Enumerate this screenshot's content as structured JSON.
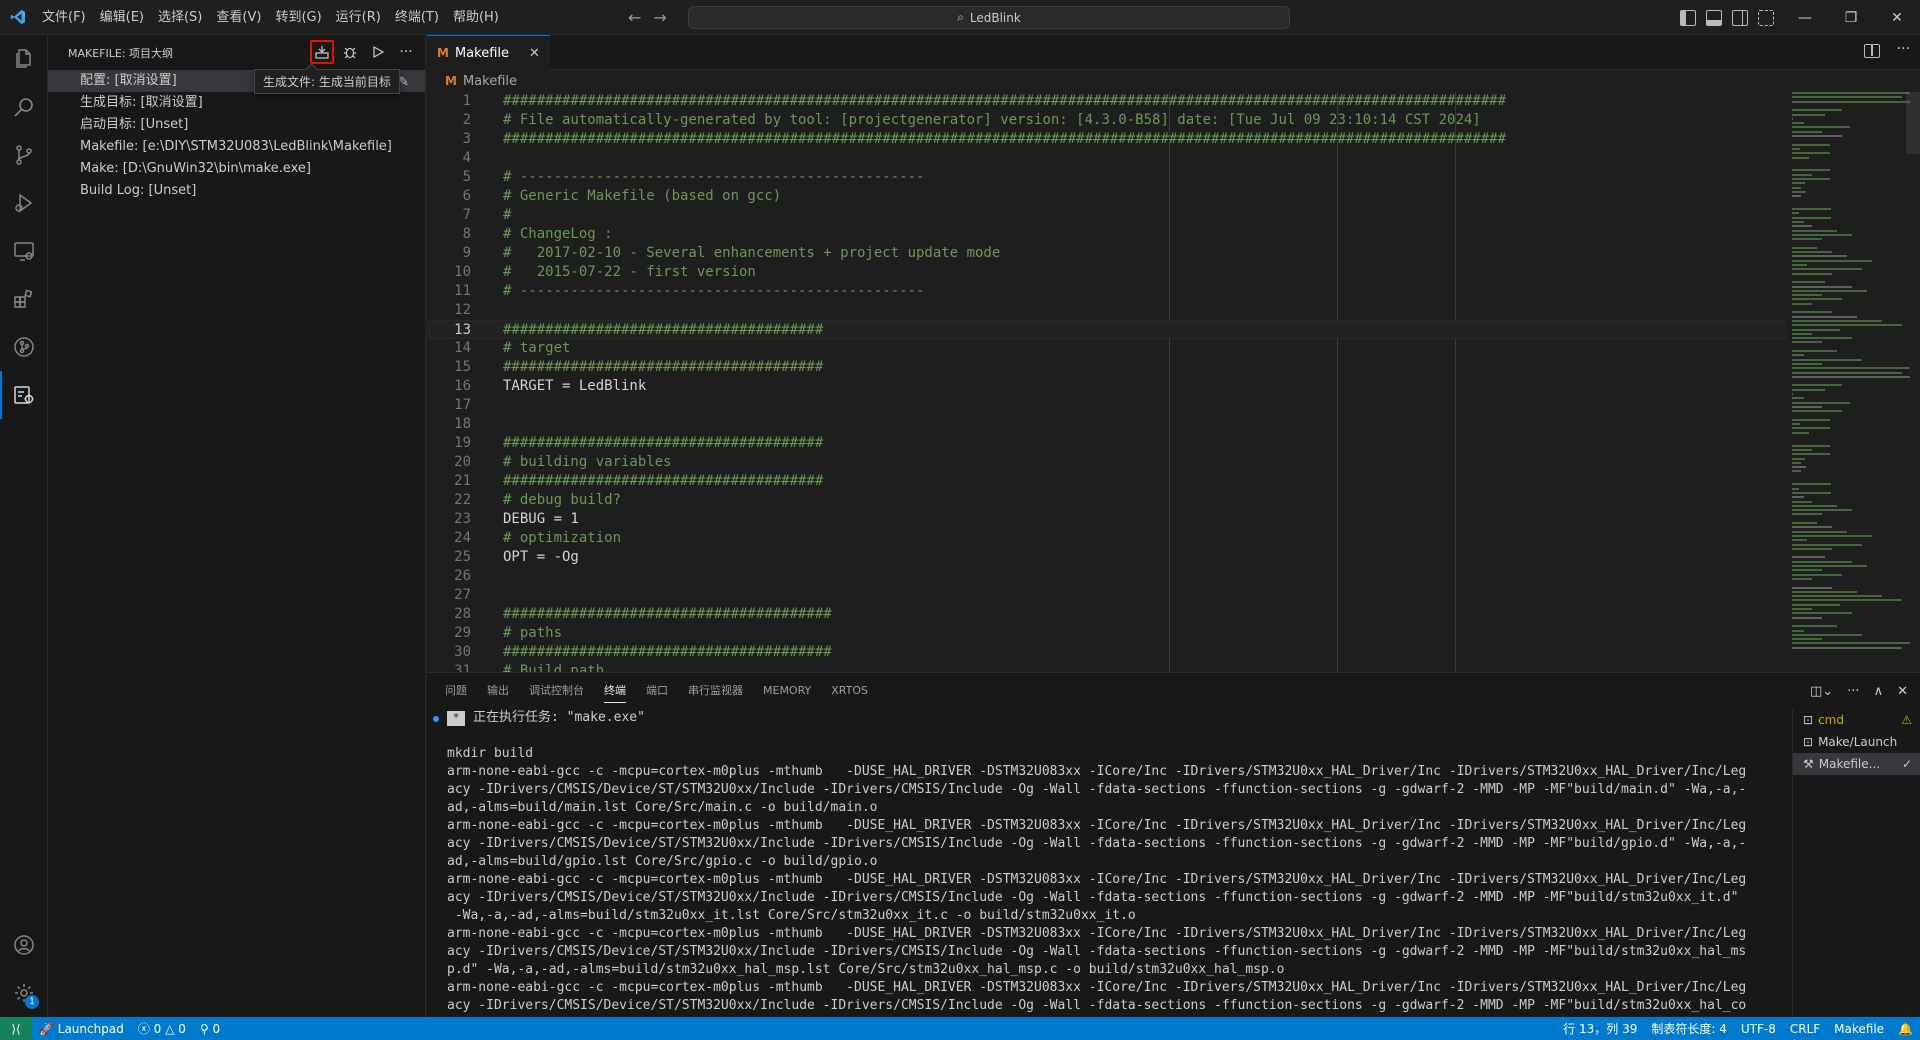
{
  "menu": [
    "文件(F)",
    "编辑(E)",
    "选择(S)",
    "查看(V)",
    "转到(G)",
    "运行(R)",
    "终端(T)",
    "帮助(H)"
  ],
  "command_center": {
    "text": "LedBlink"
  },
  "sidebar": {
    "title": "MAKEFILE: 项目大纲",
    "tooltip": "生成文件: 生成当前目标",
    "items": [
      {
        "label": "配置: [取消设置]"
      },
      {
        "label": "生成目标: [取消设置]"
      },
      {
        "label": "启动目标: [Unset]"
      },
      {
        "label": "Makefile: [e:\\DIY\\STM32U083\\LedBlink\\Makefile]"
      },
      {
        "label": "Make: [D:\\GnuWin32\\bin\\make.exe]"
      },
      {
        "label": "Build Log: [Unset]"
      }
    ]
  },
  "editor": {
    "tab": "Makefile",
    "breadcrumb": "Makefile",
    "lines": [
      {
        "n": "1",
        "t": "#######################################################################################################################",
        "c": true
      },
      {
        "n": "2",
        "t": "# File automatically-generated by tool: [projectgenerator] version: [4.3.0-B58] date: [Tue Jul 09 23:10:14 CST 2024]",
        "c": true
      },
      {
        "n": "3",
        "t": "#######################################################################################################################",
        "c": true
      },
      {
        "n": "4",
        "t": "",
        "c": false
      },
      {
        "n": "5",
        "t": "# ------------------------------------------------",
        "c": true
      },
      {
        "n": "6",
        "t": "# Generic Makefile (based on gcc)",
        "c": true
      },
      {
        "n": "7",
        "t": "#",
        "c": true
      },
      {
        "n": "8",
        "t": "# ChangeLog :",
        "c": true
      },
      {
        "n": "9",
        "t": "#   2017-02-10 - Several enhancements + project update mode",
        "c": true
      },
      {
        "n": "10",
        "t": "#   2015-07-22 - first version",
        "c": true
      },
      {
        "n": "11",
        "t": "# ------------------------------------------------",
        "c": true
      },
      {
        "n": "12",
        "t": "",
        "c": false
      },
      {
        "n": "13",
        "t": "######################################",
        "c": true
      },
      {
        "n": "14",
        "t": "# target",
        "c": true
      },
      {
        "n": "15",
        "t": "######################################",
        "c": true
      },
      {
        "n": "16",
        "t": "TARGET = LedBlink",
        "c": false
      },
      {
        "n": "17",
        "t": "",
        "c": false
      },
      {
        "n": "18",
        "t": "",
        "c": false
      },
      {
        "n": "19",
        "t": "######################################",
        "c": true
      },
      {
        "n": "20",
        "t": "# building variables",
        "c": true
      },
      {
        "n": "21",
        "t": "######################################",
        "c": true
      },
      {
        "n": "22",
        "t": "# debug build?",
        "c": true
      },
      {
        "n": "23",
        "t": "DEBUG = 1",
        "c": false
      },
      {
        "n": "24",
        "t": "# optimization",
        "c": true
      },
      {
        "n": "25",
        "t": "OPT = -Og",
        "c": false
      },
      {
        "n": "26",
        "t": "",
        "c": false
      },
      {
        "n": "27",
        "t": "",
        "c": false
      },
      {
        "n": "28",
        "t": "#######################################",
        "c": true
      },
      {
        "n": "29",
        "t": "# paths",
        "c": true
      },
      {
        "n": "30",
        "t": "#######################################",
        "c": true
      },
      {
        "n": "31",
        "t": "# Build path",
        "c": true
      }
    ]
  },
  "panel": {
    "tabs": [
      "问题",
      "输出",
      "调试控制台",
      "终端",
      "端口",
      "串行监视器",
      "MEMORY",
      "XRTOS"
    ],
    "active_tab": "终端",
    "task_line": "正在执行任务: \"make.exe\"",
    "terminal_lines": [
      "",
      "mkdir build",
      "arm-none-eabi-gcc -c -mcpu=cortex-m0plus -mthumb   -DUSE_HAL_DRIVER -DSTM32U083xx -ICore/Inc -IDrivers/STM32U0xx_HAL_Driver/Inc -IDrivers/STM32U0xx_HAL_Driver/Inc/Leg",
      "acy -IDrivers/CMSIS/Device/ST/STM32U0xx/Include -IDrivers/CMSIS/Include -Og -Wall -fdata-sections -ffunction-sections -g -gdwarf-2 -MMD -MP -MF\"build/main.d\" -Wa,-a,-",
      "ad,-alms=build/main.lst Core/Src/main.c -o build/main.o",
      "arm-none-eabi-gcc -c -mcpu=cortex-m0plus -mthumb   -DUSE_HAL_DRIVER -DSTM32U083xx -ICore/Inc -IDrivers/STM32U0xx_HAL_Driver/Inc -IDrivers/STM32U0xx_HAL_Driver/Inc/Leg",
      "acy -IDrivers/CMSIS/Device/ST/STM32U0xx/Include -IDrivers/CMSIS/Include -Og -Wall -fdata-sections -ffunction-sections -g -gdwarf-2 -MMD -MP -MF\"build/gpio.d\" -Wa,-a,-",
      "ad,-alms=build/gpio.lst Core/Src/gpio.c -o build/gpio.o",
      "arm-none-eabi-gcc -c -mcpu=cortex-m0plus -mthumb   -DUSE_HAL_DRIVER -DSTM32U083xx -ICore/Inc -IDrivers/STM32U0xx_HAL_Driver/Inc -IDrivers/STM32U0xx_HAL_Driver/Inc/Leg",
      "acy -IDrivers/CMSIS/Device/ST/STM32U0xx/Include -IDrivers/CMSIS/Include -Og -Wall -fdata-sections -ffunction-sections -g -gdwarf-2 -MMD -MP -MF\"build/stm32u0xx_it.d\"",
      " -Wa,-a,-ad,-alms=build/stm32u0xx_it.lst Core/Src/stm32u0xx_it.c -o build/stm32u0xx_it.o",
      "arm-none-eabi-gcc -c -mcpu=cortex-m0plus -mthumb   -DUSE_HAL_DRIVER -DSTM32U083xx -ICore/Inc -IDrivers/STM32U0xx_HAL_Driver/Inc -IDrivers/STM32U0xx_HAL_Driver/Inc/Leg",
      "acy -IDrivers/CMSIS/Device/ST/STM32U0xx/Include -IDrivers/CMSIS/Include -Og -Wall -fdata-sections -ffunction-sections -g -gdwarf-2 -MMD -MP -MF\"build/stm32u0xx_hal_ms",
      "p.d\" -Wa,-a,-ad,-alms=build/stm32u0xx_hal_msp.lst Core/Src/stm32u0xx_hal_msp.c -o build/stm32u0xx_hal_msp.o",
      "arm-none-eabi-gcc -c -mcpu=cortex-m0plus -mthumb   -DUSE_HAL_DRIVER -DSTM32U083xx -ICore/Inc -IDrivers/STM32U0xx_HAL_Driver/Inc -IDrivers/STM32U0xx_HAL_Driver/Inc/Leg",
      "acy -IDrivers/CMSIS/Device/ST/STM32U0xx/Include -IDrivers/CMSIS/Include -Og -Wall -fdata-sections -ffunction-sections -g -gdwarf-2 -MMD -MP -MF\"build/stm32u0xx_hal_co"
    ],
    "terminals": [
      {
        "label": "cmd",
        "status": "⚠"
      },
      {
        "label": "Make/Launch",
        "status": ""
      },
      {
        "label": "Makefile...",
        "status": "✓"
      }
    ]
  },
  "statusbar": {
    "launchpad": "Launchpad",
    "errors": "0",
    "warnings": "0",
    "ports": "0",
    "position": "行 13，列 39",
    "tab_size": "制表符长度: 4",
    "encoding": "UTF-8",
    "eol": "CRLF",
    "language": "Makefile",
    "settings_badge": "1"
  },
  "colors": {
    "accent": "#0078d4",
    "statusbar": "#007acc",
    "comment": "#6a9955",
    "highlight": "#e51400"
  }
}
